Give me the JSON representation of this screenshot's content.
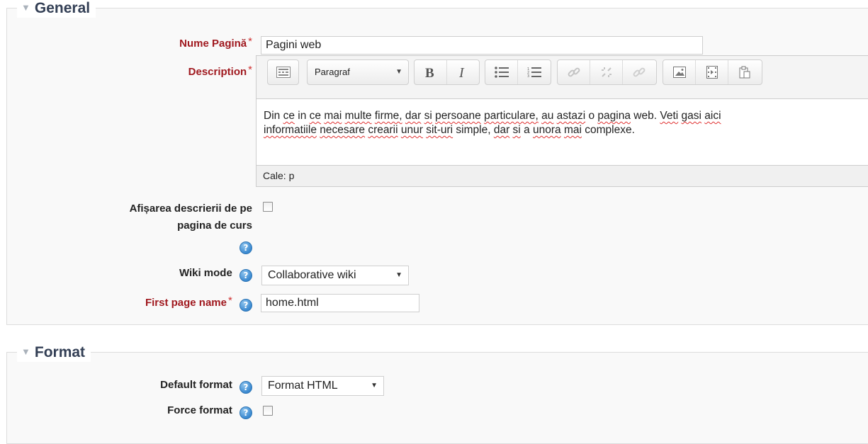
{
  "general": {
    "legend": "General",
    "page_name": {
      "label": "Nume Pagină",
      "value": "Pagini web"
    },
    "description": {
      "label": "Description",
      "format_select": "Paragraf",
      "content_line1_words": [
        "Din",
        "ce",
        "in",
        "ce",
        "mai",
        "multe",
        "firme,",
        "dar",
        "si",
        "persoane",
        "particulare,",
        "au",
        "astazi",
        "o",
        "pagina",
        "web.",
        "Veti",
        "gasi",
        "aici"
      ],
      "content_line2_words": [
        "informatiile",
        "necesare",
        "crearii",
        "unur",
        "sit-uri",
        "simple,",
        "dar",
        "si",
        "a",
        "unora",
        "mai",
        "complexe."
      ],
      "content": "Din ce in ce mai multe firme, dar si persoane particulare, au astazi o pagina web. Veti gasi aici informatiile necesare crearii unur sit-uri simple, dar si a unora mai complexe.",
      "status_path": "Cale: p"
    },
    "show_description": {
      "label_line1": "Afișarea descrierii de pe",
      "label_line2": "pagina de curs",
      "checked": false
    },
    "wiki_mode": {
      "label": "Wiki mode",
      "value": "Collaborative wiki"
    },
    "first_page": {
      "label": "First page name",
      "value": "home.html"
    }
  },
  "format": {
    "legend": "Format",
    "default_format": {
      "label": "Default format",
      "value": "Format HTML"
    },
    "force_format": {
      "label": "Force format",
      "checked": false
    }
  },
  "ui": {
    "required_marker": "*",
    "help_glyph": "?",
    "dropdown_caret": "▼",
    "legend_caret": "▼"
  },
  "colors": {
    "required_label": "#a0191f",
    "legend_text": "#333f55",
    "help_icon": "#3a89d0",
    "spellcheck_underline": "#e03030"
  }
}
